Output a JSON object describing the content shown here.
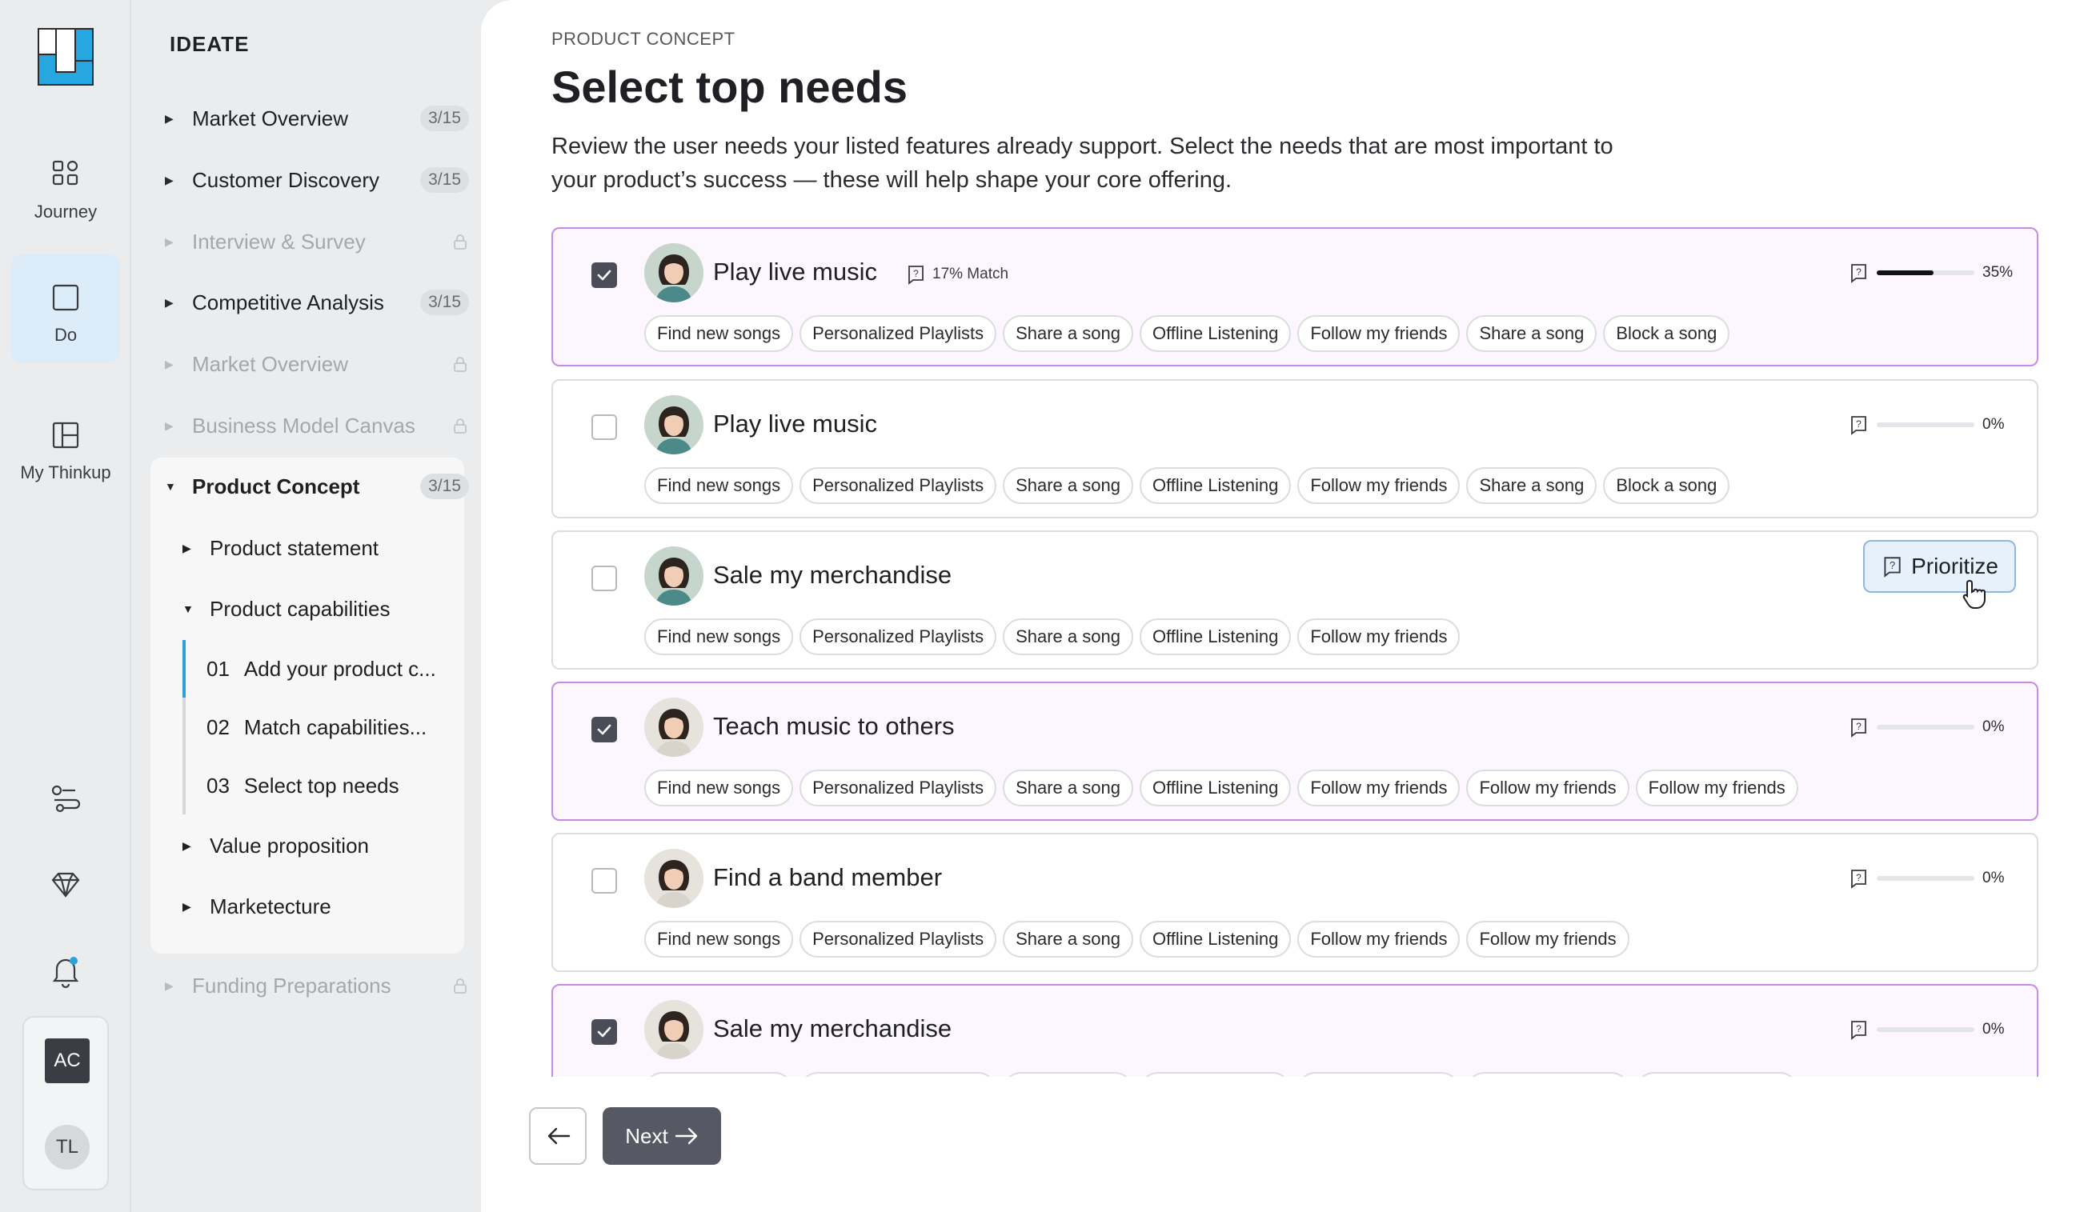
{
  "rail": {
    "items": [
      {
        "label": "Journey",
        "icon": "journey-icon"
      },
      {
        "label": "Do",
        "icon": "square-icon"
      },
      {
        "label": "My Thinkup",
        "icon": "layout-icon"
      }
    ],
    "user_initials": [
      "AC",
      "TL"
    ]
  },
  "nav": {
    "section_title": "IDEATE",
    "items": [
      {
        "label": "Market Overview",
        "badge": "3/15",
        "locked": false
      },
      {
        "label": "Customer Discovery",
        "badge": "3/15",
        "locked": false
      },
      {
        "label": "Interview & Survey",
        "badge": "",
        "locked": true
      },
      {
        "label": "Competitive Analysis",
        "badge": "3/15",
        "locked": false
      },
      {
        "label": "Market Overview",
        "badge": "",
        "locked": true
      },
      {
        "label": "Business Model Canvas",
        "badge": "",
        "locked": true
      },
      {
        "label": "Product Concept",
        "badge": "3/15",
        "locked": false,
        "expanded": true
      },
      {
        "label": "Funding Preparations",
        "badge": "",
        "locked": true
      }
    ],
    "concept_children": [
      {
        "label": "Product statement"
      },
      {
        "label": "Product capabilities"
      },
      {
        "label": "Value proposition"
      },
      {
        "label": "Marketecture"
      }
    ],
    "steps": [
      {
        "num": "01",
        "label": "Add your product c..."
      },
      {
        "num": "02",
        "label": "Match capabilities..."
      },
      {
        "num": "03",
        "label": "Select top needs"
      }
    ]
  },
  "main": {
    "eyebrow": "PRODUCT CONCEPT",
    "title": "Select top needs",
    "description": "Review the user needs your listed features already support. Select the needs that are most important to your product’s success — these will help shape your core offering.",
    "cards": [
      {
        "title": "Play live music",
        "checked": true,
        "match": "17% Match",
        "percent": "35%",
        "progress": 0.35,
        "tags": [
          "Find new songs",
          "Personalized Playlists",
          "Share a song",
          "Offline Listening",
          "Follow my friends",
          "Share a song",
          "Block a song"
        ]
      },
      {
        "title": "Play live music",
        "checked": false,
        "match": "",
        "percent": "0%",
        "progress": 0,
        "tags": [
          "Find new songs",
          "Personalized Playlists",
          "Share a song",
          "Offline Listening",
          "Follow my friends",
          "Share a song",
          "Block a song"
        ]
      },
      {
        "title": "Sale my merchandise",
        "checked": false,
        "match": "",
        "percent": "",
        "progress": 0,
        "action": "Prioritize",
        "tags": [
          "Find new songs",
          "Personalized Playlists",
          "Share a song",
          "Offline Listening",
          "Follow my friends"
        ]
      },
      {
        "title": "Teach music to others",
        "checked": true,
        "match": "",
        "percent": "0%",
        "progress": 0,
        "tags": [
          "Find new songs",
          "Personalized Playlists",
          "Share a song",
          "Offline Listening",
          "Follow my friends",
          "Follow my friends",
          "Follow my friends"
        ]
      },
      {
        "title": "Find a band member",
        "checked": false,
        "match": "",
        "percent": "0%",
        "progress": 0,
        "tags": [
          "Find new songs",
          "Personalized Playlists",
          "Share a song",
          "Offline Listening",
          "Follow my friends",
          "Follow my friends"
        ]
      },
      {
        "title": "Sale my merchandise",
        "checked": true,
        "match": "",
        "percent": "0%",
        "progress": 0,
        "tags": [
          "Find new songs",
          "Personalized Playlists",
          "Share a song",
          "Offline Listening",
          "Follow my friends",
          "Follow my friends",
          "Follow my friends"
        ]
      }
    ]
  },
  "footer": {
    "next_label": "Next"
  },
  "colors": {
    "accent_blue": "#2aa3dc",
    "selected_border": "#c98ae8",
    "selected_bg": "#fcf7fe",
    "button_dark": "#565963"
  }
}
